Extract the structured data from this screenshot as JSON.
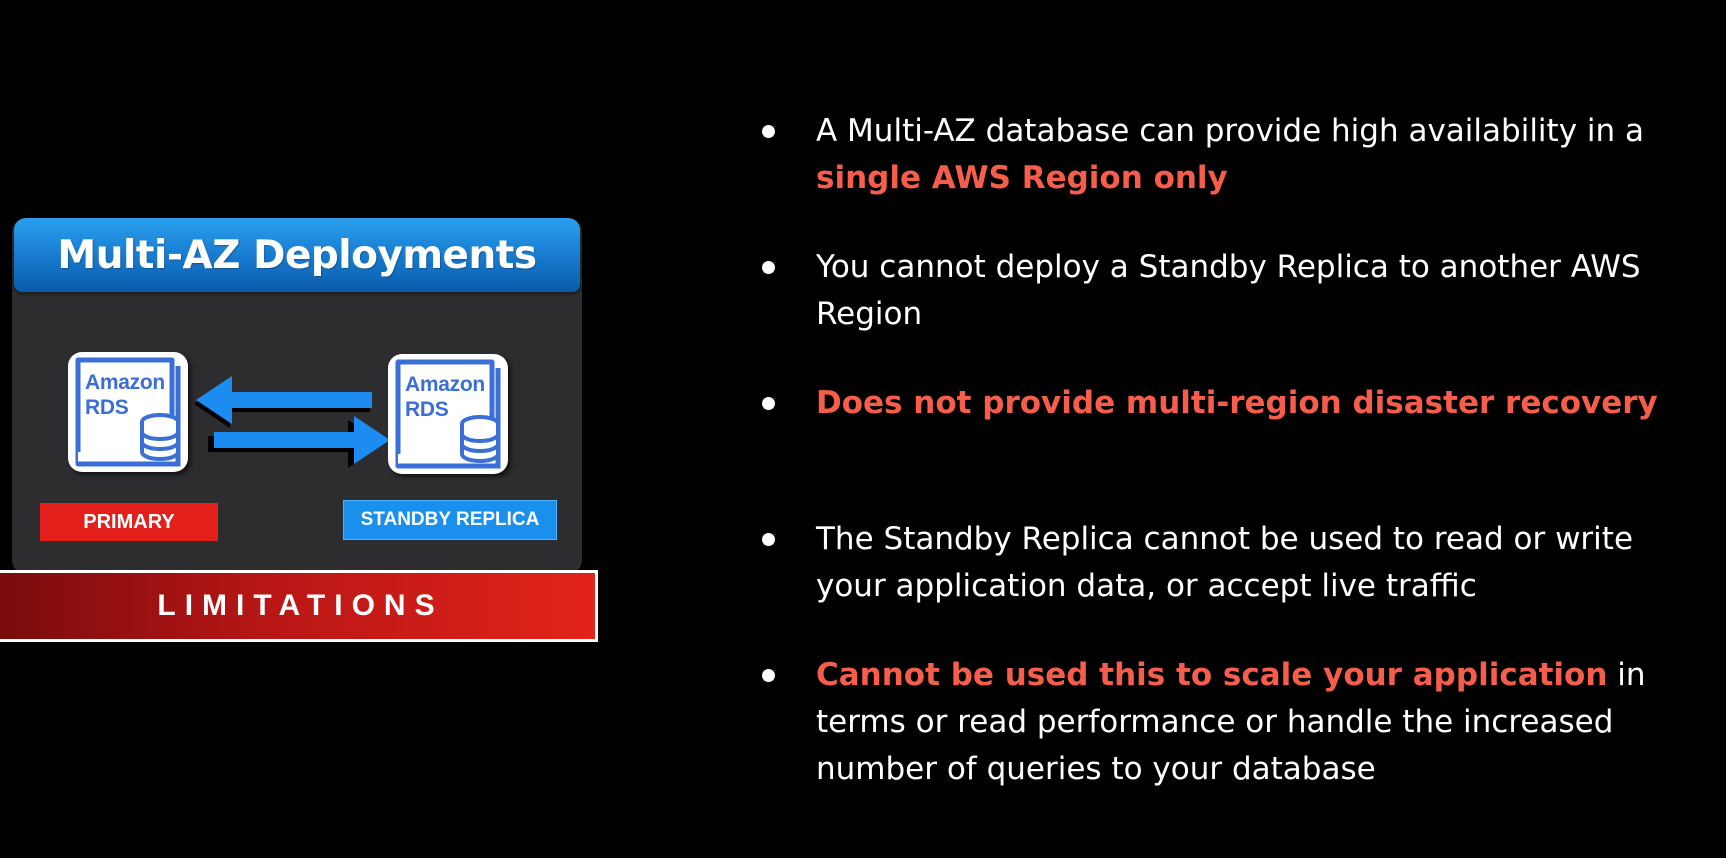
{
  "card": {
    "title": "Multi-AZ Deployments",
    "primary_logo_line1": "Amazon",
    "primary_logo_line2": "RDS",
    "standby_logo_line1": "Amazon",
    "standby_logo_line2": "RDS",
    "primary_label": "PRIMARY",
    "standby_label": "STANDBY REPLICA",
    "limitations": "LIMITATIONS"
  },
  "bullets": [
    {
      "text1": "A Multi-AZ database can provide high availability in a",
      "highlight": "single AWS Region only",
      "text2": ""
    },
    {
      "text1": "You cannot deploy a Standby Replica to another AWS Region",
      "highlight": "",
      "text2": ""
    },
    {
      "text1": "",
      "highlight": "Does not provide multi-region disaster recovery",
      "text2": ""
    },
    {
      "text1": "The Standby Replica cannot be used to read or write your application data, or accept live traffic",
      "highlight": "",
      "text2": ""
    },
    {
      "text1": "",
      "highlight": "Cannot be used this to scale your application",
      "text2": " in terms or read performance or handle the increased number of queries to your database"
    }
  ],
  "colors": {
    "background": "#000000",
    "highlight": "#f65d4a",
    "header_blue": "#1a7fd4",
    "primary_red": "#e3201b",
    "standby_blue": "#1a90ee",
    "rds_blue": "#3b6fd6"
  }
}
